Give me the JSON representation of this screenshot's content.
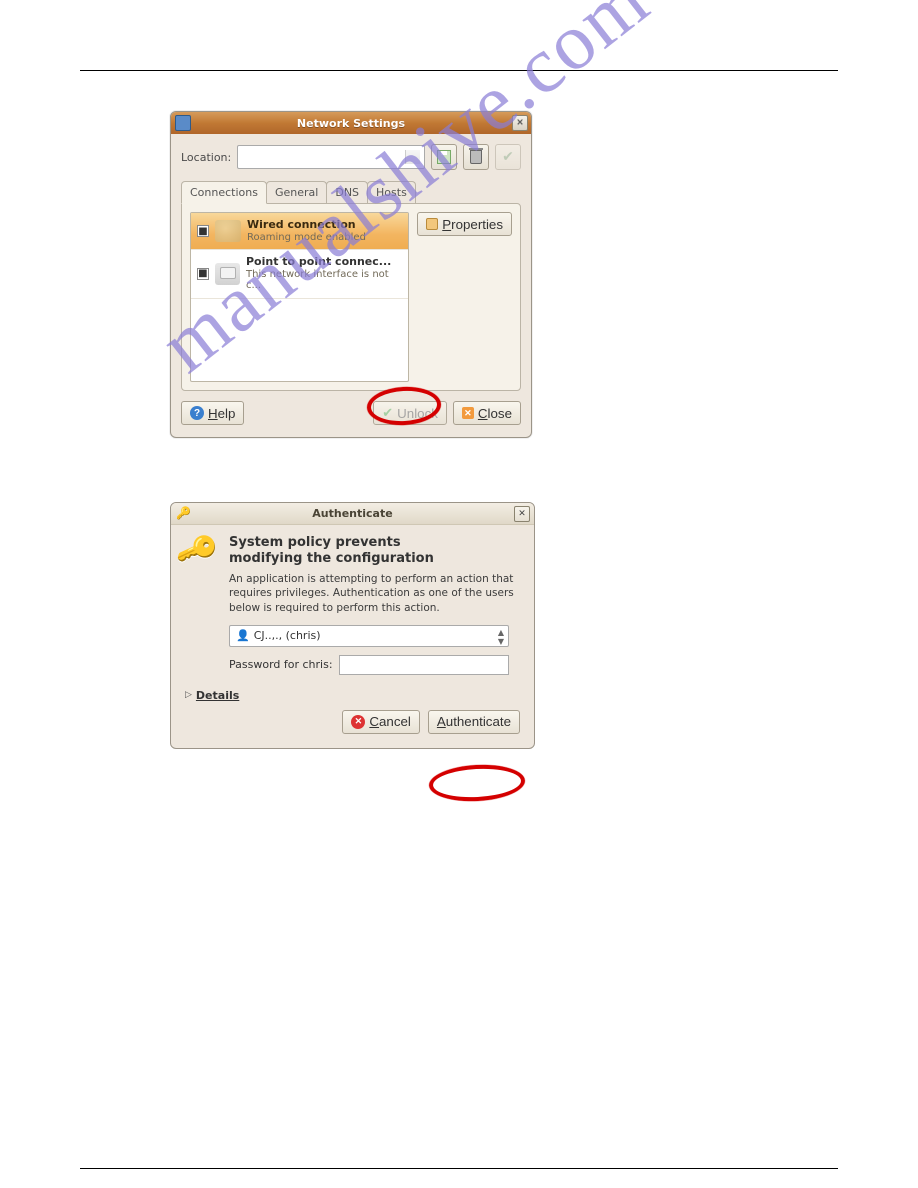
{
  "watermark": "manualshive.com",
  "win1": {
    "title": "Network Settings",
    "location_label": "Location:",
    "tabs": [
      "Connections",
      "General",
      "DNS",
      "Hosts"
    ],
    "active_tab": "Connections",
    "connections": [
      {
        "name": "Wired connection",
        "sub": "Roaming mode enabled",
        "checked": "■"
      },
      {
        "name": "Point to point connec...",
        "sub": "This network interface is not c...",
        "checked": "■"
      }
    ],
    "properties_btn": "Properties",
    "help_btn": "Help",
    "unlock_btn": "Unlock",
    "close_btn": "Close"
  },
  "win2": {
    "title": "Authenticate",
    "heading_l1": "System policy prevents",
    "heading_l2": "modifying the configuration",
    "desc": "An application is attempting to perform an action that requires privileges. Authentication as one of the users below is required to perform this action.",
    "user": "CJ..,., (chris)",
    "pw_label": "Password for chris:",
    "details": "Details",
    "cancel": "Cancel",
    "auth": "Authenticate"
  }
}
